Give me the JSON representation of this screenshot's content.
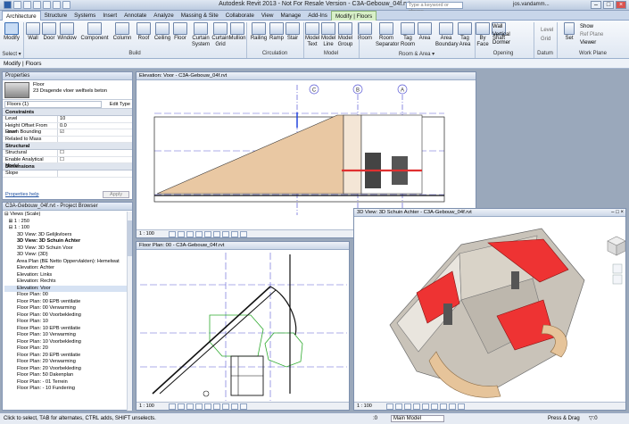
{
  "window": {
    "title": "Autodesk Revit 2013 - Not For Resale Version -  C3A-Gebouw_04f.rvt",
    "search_placeholder": "Type a keyword or phrase",
    "user": "jos.vandamm..."
  },
  "tabs": [
    "Architecture",
    "Structure",
    "Systems",
    "Insert",
    "Annotate",
    "Analyze",
    "Massing & Site",
    "Collaborate",
    "View",
    "Manage",
    "Add-Ins",
    "Modify | Floors"
  ],
  "ribbon": {
    "buttons": [
      {
        "label": "Modify",
        "icon": "cursor-icon"
      },
      {
        "label": "Wall",
        "icon": "wall-icon"
      },
      {
        "label": "Door",
        "icon": "door-icon"
      },
      {
        "label": "Window",
        "icon": "window-icon"
      },
      {
        "label": "Component",
        "icon": "component-icon"
      },
      {
        "label": "Column",
        "icon": "column-icon"
      },
      {
        "label": "Roof",
        "icon": "roof-icon"
      },
      {
        "label": "Ceiling",
        "icon": "ceiling-icon"
      },
      {
        "label": "Floor",
        "icon": "floor-icon"
      },
      {
        "label": "Curtain System",
        "icon": "curtain-system-icon"
      },
      {
        "label": "Curtain Grid",
        "icon": "curtain-grid-icon"
      },
      {
        "label": "Mullion",
        "icon": "mullion-icon"
      },
      {
        "label": "Railing",
        "icon": "railing-icon"
      },
      {
        "label": "Ramp",
        "icon": "ramp-icon"
      },
      {
        "label": "Stair",
        "icon": "stair-icon"
      },
      {
        "label": "Model Text",
        "icon": "model-text-icon"
      },
      {
        "label": "Model Line",
        "icon": "model-line-icon"
      },
      {
        "label": "Model Group",
        "icon": "model-group-icon"
      },
      {
        "label": "Room",
        "icon": "room-icon"
      },
      {
        "label": "Room Separator",
        "icon": "room-separator-icon"
      },
      {
        "label": "Tag Room",
        "icon": "tag-room-icon"
      },
      {
        "label": "Area",
        "icon": "area-icon"
      },
      {
        "label": "Area Boundary",
        "icon": "area-boundary-icon"
      },
      {
        "label": "Tag Area",
        "icon": "tag-area-icon"
      },
      {
        "label": "By Face",
        "icon": "by-face-icon"
      },
      {
        "label": "Shaft",
        "icon": "shaft-icon"
      }
    ],
    "small": {
      "wall": "Wall",
      "vertical": "Vertical",
      "dormer": "Dormer",
      "level": "Level",
      "grid": "Grid",
      "set": "Set",
      "show": "Show",
      "ref_plane": "Ref Plane",
      "viewer": "Viewer"
    },
    "panels": [
      "Select ▾",
      "Build",
      "Circulation",
      "Model",
      "Room & Area ▾",
      "Opening",
      "Datum",
      "Work Plane"
    ]
  },
  "modify_bar": "Modify | Floors",
  "properties": {
    "title": "Properties",
    "type_family": "Floor",
    "type_name": "23 Dragende vloer welfsels beton",
    "selector": "Floors (1)",
    "edit_type": "Edit Type",
    "constraints_cat": "Constraints",
    "rows": [
      {
        "k": "Level",
        "v": "10"
      },
      {
        "k": "Height Offset From Level",
        "v": "0.0"
      },
      {
        "k": "Room Bounding",
        "v": "☑"
      },
      {
        "k": "Related to Mass",
        "v": ""
      }
    ],
    "structural_cat": "Structural",
    "srows": [
      {
        "k": "Structural",
        "v": "☐"
      },
      {
        "k": "Enable Analytical Model",
        "v": "☐"
      }
    ],
    "dimensions_cat": "Dimensions",
    "drows": [
      {
        "k": "Slope",
        "v": ""
      }
    ],
    "help": "Properties help",
    "apply": "Apply"
  },
  "browser": {
    "title": "C3A-Gebouw_04f.rvt - Project Browser",
    "items": [
      "⊟ Views (Scale)",
      "   ⊞ 1 : 250",
      "   ⊟ 1 : 100",
      "         3D View: 3D Gelijkvloers",
      "         3D View: 3D Schuin Achter",
      "         3D View: 3D Schuin Voor",
      "         3D View: {3D}",
      "         Area Plan (BE Netto Oppervlakten): Hemelwat",
      "         Elevation: Achter",
      "         Elevation: Links",
      "         Elevation: Rechts",
      "         Elevation: Voor",
      "         Floor Plan: 00",
      "         Floor Plan: 00 EPB ventilatie",
      "         Floor Plan: 00 Verwarming",
      "         Floor Plan: 00 Voorbekleding",
      "         Floor Plan: 10",
      "         Floor Plan: 10 EPB ventilatie",
      "         Floor Plan: 10 Verwarming",
      "         Floor Plan: 10 Voorbekleding",
      "         Floor Plan: 20",
      "         Floor Plan: 20 EPB ventilatie",
      "         Floor Plan: 20 Verwarming",
      "         Floor Plan: 20 Voorbekleding",
      "         Floor Plan: 50 Dakenplan",
      "         Floor Plan: - 01 Terrein",
      "         Floor Plan: - 10 Fundering"
    ]
  },
  "views": {
    "elevation": {
      "title": "Elevation: Voor - C3A-Gebouw_04f.rvt",
      "scale": "1 : 100",
      "grids": [
        "C",
        "B",
        "A"
      ]
    },
    "plan": {
      "title": "Floor Plan: 00 - C3A-Gebouw_04f.rvt",
      "scale": "1 : 100"
    },
    "three_d": {
      "title": "3D View: 3D Schuin Achter - C3A-Gebouw_04f.rvt",
      "scale": "1 : 100"
    }
  },
  "status": {
    "hint": "Click to select, TAB for alternates, CTRL adds, SHIFT unselects.",
    "coord": ":0",
    "model": "Main Model",
    "press_drag": "Press & Drag",
    "filter": "▽:0"
  }
}
